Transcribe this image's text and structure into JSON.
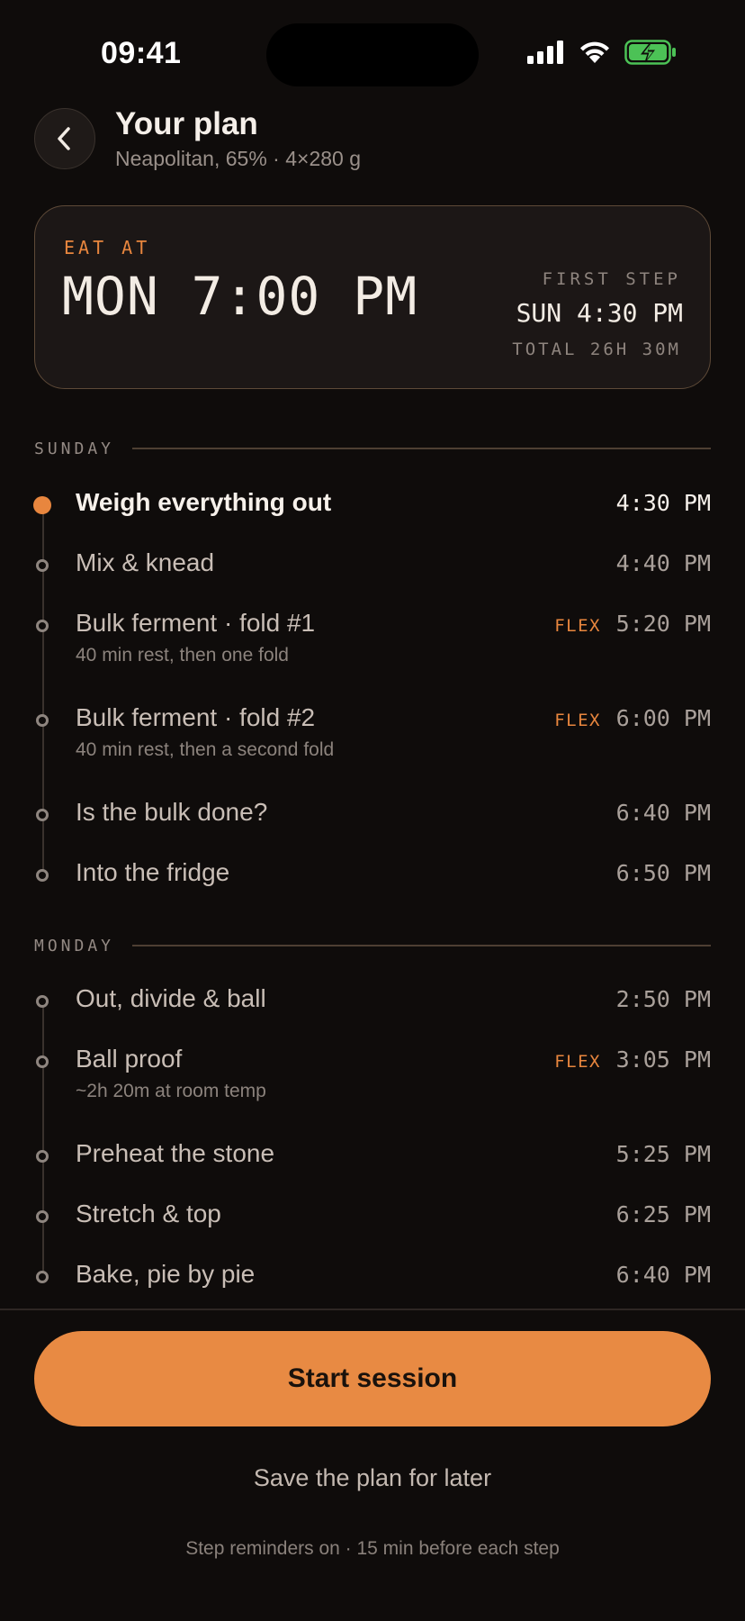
{
  "status_bar": {
    "time": "09:41"
  },
  "header": {
    "title": "Your plan",
    "subtitle": "Neapolitan, 65% · 4×280 g"
  },
  "summary": {
    "eat_label": "EAT AT",
    "eat_time": "MON 7:00 PM",
    "first_step_label": "FIRST STEP",
    "first_step_time": "SUN 4:30 PM",
    "total": "TOTAL 26H 30M"
  },
  "days": [
    {
      "label": "SUNDAY",
      "steps": [
        {
          "title": "Weigh everything out",
          "time": "4:30 PM",
          "active": true
        },
        {
          "title": "Mix & knead",
          "time": "4:40 PM"
        },
        {
          "title": "Bulk ferment · fold #1",
          "note": "40 min rest, then one fold",
          "flex": "FLEX",
          "time": "5:20 PM"
        },
        {
          "title": "Bulk ferment · fold #2",
          "note": "40 min rest, then a second fold",
          "flex": "FLEX",
          "time": "6:00 PM"
        },
        {
          "title": "Is the bulk done?",
          "time": "6:40 PM"
        },
        {
          "title": "Into the fridge",
          "time": "6:50 PM"
        }
      ]
    },
    {
      "label": "MONDAY",
      "steps": [
        {
          "title": "Out, divide & ball",
          "time": "2:50 PM"
        },
        {
          "title": "Ball proof",
          "note": "~2h 20m at room temp",
          "flex": "FLEX",
          "time": "3:05 PM"
        },
        {
          "title": "Preheat the stone",
          "time": "5:25 PM"
        },
        {
          "title": "Stretch & top",
          "time": "6:25 PM"
        },
        {
          "title": "Bake, pie by pie",
          "time": "6:40 PM"
        }
      ]
    }
  ],
  "actions": {
    "start_label": "Start session",
    "save_label": "Save the plan for later",
    "reminder_note": "Step reminders on · 15 min before each step"
  },
  "colors": {
    "accent": "#e88a43",
    "background": "#0f0c0b",
    "card": "#1c1716",
    "battery": "#4cc256"
  },
  "icons": {
    "back": "chevron-left-icon",
    "signal": "cellular-signal-icon",
    "wifi": "wifi-icon",
    "battery": "battery-charging-icon"
  }
}
